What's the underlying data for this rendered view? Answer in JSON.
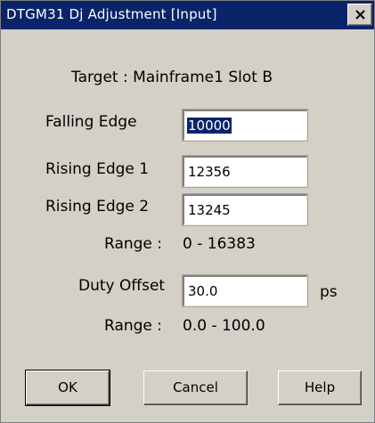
{
  "window": {
    "title": "DTGM31 Dj Adjustment [Input]",
    "close_icon": "close-icon"
  },
  "target": {
    "text": "Target : Mainframe1 Slot B"
  },
  "edges": {
    "falling_label": "Falling Edge",
    "falling_value": "10000",
    "rising1_label": "Rising Edge 1",
    "rising1_value": "12356",
    "rising2_label": "Rising Edge 2",
    "rising2_value": "13245",
    "range_label": "Range :",
    "range_value": "0  -  16383"
  },
  "duty": {
    "label": "Duty Offset",
    "value": "30.0",
    "unit": "ps",
    "range_label": "Range :",
    "range_value": "0.0  -  100.0"
  },
  "buttons": {
    "ok": "OK",
    "cancel": "Cancel",
    "help": "Help"
  },
  "colors": {
    "title_bar": "#0a246a",
    "dialog_bg": "#d4d0c8",
    "selection": "#0a246a"
  }
}
